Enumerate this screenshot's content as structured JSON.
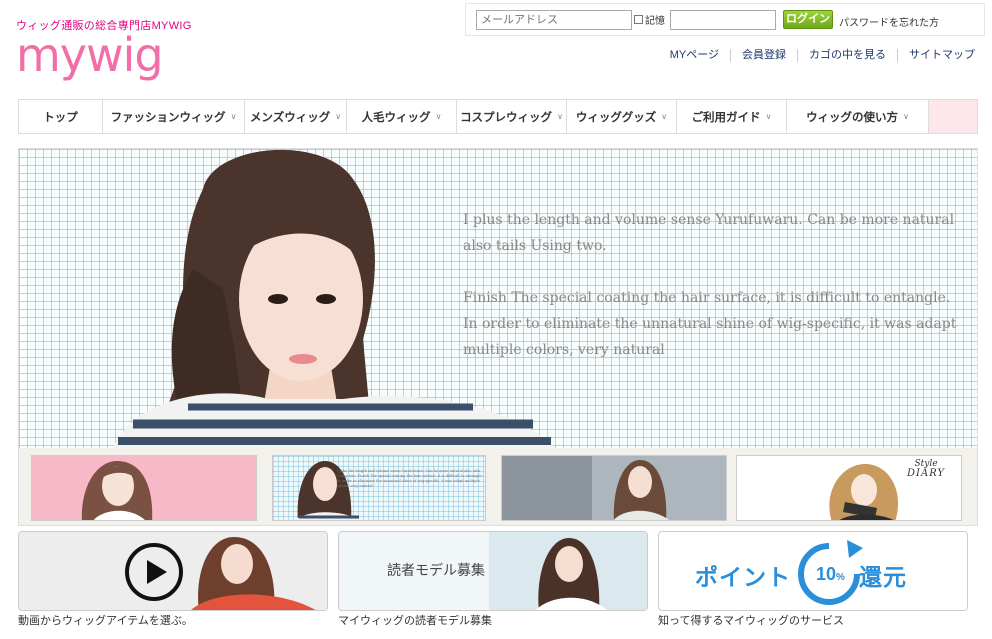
{
  "header": {
    "tagline": "ウィッグ通販の総合専門店MYWIG",
    "logo_text": "mywig",
    "logo_color": "#f06fa8"
  },
  "login": {
    "email_placeholder": "メールアドレス",
    "remember_label": "記憶",
    "password_placeholder": "",
    "login_button": "ログイン",
    "forgot_link": "パスワードを忘れた方"
  },
  "util_links": [
    "MYページ",
    "会員登録",
    "カゴの中を見る",
    "サイトマップ"
  ],
  "nav": {
    "items": [
      {
        "label": "トップ",
        "chevron": ""
      },
      {
        "label": "ファッションウィッグ",
        "chevron": "∨"
      },
      {
        "label": "メンズウィッグ",
        "chevron": "∨"
      },
      {
        "label": "人毛ウィッグ",
        "chevron": "∨"
      },
      {
        "label": "コスプレウィッグ",
        "chevron": "∨"
      },
      {
        "label": "ウィッググッズ",
        "chevron": "∨"
      },
      {
        "label": "ご利用ガイド",
        "chevron": "∨"
      },
      {
        "label": "ウィッグの使い方",
        "chevron": "∨"
      }
    ]
  },
  "hero": {
    "paragraph1": "I plus the length and volume sense Yurufuwaru. Can be more natural also tails Using two.",
    "paragraph2": "Finish The special coating the hair surface, it is difficult to entangle. In order to eliminate the unnatural shine of wig-specific, it was adapt multiple colors, very natural"
  },
  "thumbs": {
    "t2_text": "I plus the length and volume sense Yurufuwaru. Can be more natural also tails Using two. Finish The special coating the hair surface, it is difficult to entangle. In order to eliminate the unnatural shine of wig-specific, it was adapt multiple colors, very natural",
    "t4_title_line1": "Style",
    "t4_title_line2": "DIARY"
  },
  "banners": [
    {
      "caption": "動画からウィッグアイテムを選ぶ。"
    },
    {
      "caption": "マイウィッグの読者モデル募集",
      "label": "読者モデル募集"
    },
    {
      "caption": "知って得するマイウィッグのサービス",
      "label_left": "ポイント",
      "label_number": "10",
      "label_percent": "%",
      "label_right": "還元"
    }
  ],
  "colors": {
    "accent_pink": "#e4007f",
    "login_green": "#7cb82a",
    "point_blue": "#2a8fd8"
  }
}
